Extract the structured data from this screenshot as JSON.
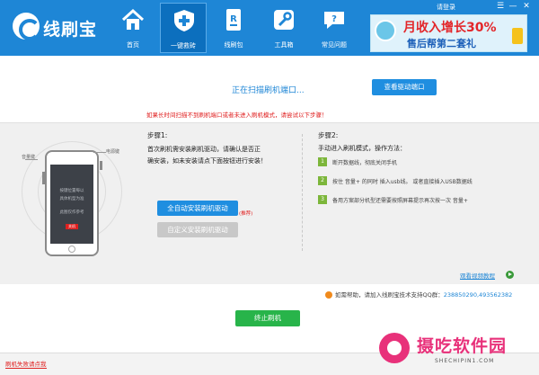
{
  "app": {
    "name": "线刷宝"
  },
  "nav": {
    "items": [
      {
        "label": "首页",
        "icon": "home-icon"
      },
      {
        "label": "一键救砖",
        "icon": "shield-plus-icon"
      },
      {
        "label": "线刷包",
        "icon": "rom-package-icon"
      },
      {
        "label": "工具箱",
        "icon": "wrench-icon"
      },
      {
        "label": "常见问题",
        "icon": "question-chat-icon"
      }
    ]
  },
  "window": {
    "login": "请登录",
    "menu": "☰",
    "minimize": "—",
    "close": "✕"
  },
  "promo": {
    "line1": "月收入增长30%",
    "line2": "售后帮第二套礼"
  },
  "scan": {
    "status": "正在扫描刷机端口...",
    "view_ports_button": "查看驱动端口",
    "warning": "如果长时间扫描不到刷机端口或者未进入刷机模式，请尝试以下步骤！"
  },
  "illustration": {
    "volume_key": "音量键",
    "power_key": "电源键",
    "screen_lines": [
      "按键位置每以",
      "具体机型为准",
      "此图仅作参考"
    ],
    "red_label": "关机"
  },
  "step1": {
    "title": "步骤1:",
    "desc_line1": "首次刷机需安装刷机驱动，请确认是否正",
    "desc_line2": "确安装，如未安装请点下面按钮进行安装！",
    "auto_button": "全自动安装刷机驱动",
    "recommend": "(推荐)",
    "custom_button": "自定义安装刷机驱动"
  },
  "step2": {
    "title": "步骤2:",
    "subtitle": "手动进入刷机模式，操作方法：",
    "items": [
      {
        "num": "1",
        "text": "断开数据线，彻底关闭手机"
      },
      {
        "num": "2",
        "text": "按住 音量+   的同时  插入usb线。  或者直接插入USB数据线"
      },
      {
        "num": "3",
        "text": "备用方案部分机型还需要按照屏幕提示再次按一次 音量+"
      }
    ],
    "video_link": "观看视频教程"
  },
  "help": {
    "text": "如需帮助，请加入线刷宝技术支持QQ群：",
    "qq": "238850290,493562382"
  },
  "stop_button": "终止刷机",
  "status_bar": {
    "fail_link": "刷机失败请点我"
  },
  "watermark": {
    "name": "摄吃软件园",
    "url": "SHECHIPIN1.COM"
  },
  "colors": {
    "header": "#1e86d6",
    "accent_green": "#28b44a",
    "warning_red": "#e02020"
  }
}
